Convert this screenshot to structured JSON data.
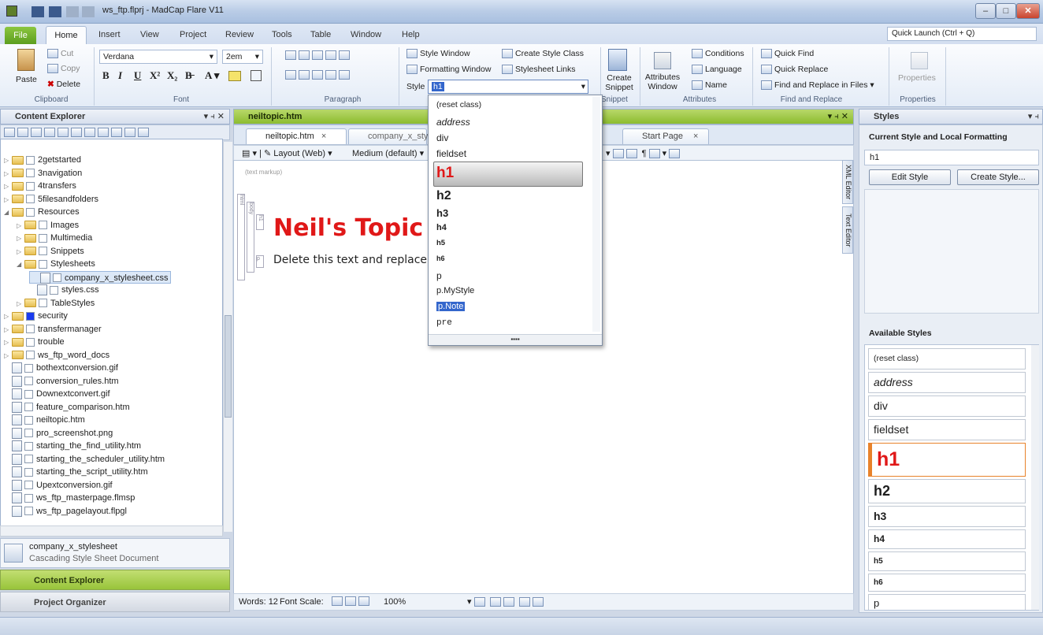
{
  "window": {
    "title": "ws_ftp.flprj - MadCap Flare V11",
    "quick_launch": "Quick Launch (Ctrl + Q)"
  },
  "ribbon_tabs": [
    "File",
    "Home",
    "Insert",
    "View",
    "Project",
    "Review",
    "Tools",
    "Table",
    "Window",
    "Help"
  ],
  "clipboard": {
    "paste": "Paste",
    "cut": "Cut",
    "copy": "Copy",
    "delete": "Delete",
    "label": "Clipboard"
  },
  "font": {
    "family": "Verdana",
    "size": "2em",
    "label": "Font"
  },
  "paragraph": {
    "label": "Paragraph"
  },
  "styles_group": {
    "style_window": "Style Window",
    "formatting_window": "Formatting Window",
    "create_style_class": "Create Style Class",
    "stylesheet_links": "Stylesheet Links",
    "style_label": "Style",
    "style_value": "h1",
    "label": "Styles"
  },
  "snippet": {
    "create": "Create",
    "snippet": "Snippet",
    "label": "Snippet"
  },
  "attributes": {
    "window1": "Attributes",
    "window2": "Window",
    "conditions": "Conditions",
    "language": "Language",
    "name": "Name",
    "label": "Attributes"
  },
  "find": {
    "quick_find": "Quick Find",
    "quick_replace": "Quick Replace",
    "find_replace_files": "Find and Replace in Files",
    "label": "Find and Replace"
  },
  "properties": {
    "button": "Properties",
    "label": "Properties"
  },
  "content_explorer": {
    "title": "Content Explorer",
    "items": [
      {
        "label": "2getstarted",
        "kind": "folder",
        "indent": 0,
        "expander": "▷"
      },
      {
        "label": "3navigation",
        "kind": "folder",
        "indent": 0,
        "expander": "▷"
      },
      {
        "label": "4transfers",
        "kind": "folder",
        "indent": 0,
        "expander": "▷"
      },
      {
        "label": "5filesandfolders",
        "kind": "folder",
        "indent": 0,
        "expander": "▷"
      },
      {
        "label": "Resources",
        "kind": "folder",
        "indent": 0,
        "expander": "◢"
      },
      {
        "label": "Images",
        "kind": "folder",
        "indent": 1,
        "expander": "▷"
      },
      {
        "label": "Multimedia",
        "kind": "folder",
        "indent": 1,
        "expander": "▷"
      },
      {
        "label": "Snippets",
        "kind": "folder",
        "indent": 1,
        "expander": "▷"
      },
      {
        "label": "Stylesheets",
        "kind": "folder",
        "indent": 1,
        "expander": "◢"
      },
      {
        "label": "company_x_stylesheet.css",
        "kind": "file",
        "indent": 2,
        "expander": "",
        "selected": true
      },
      {
        "label": "styles.css",
        "kind": "file",
        "indent": 2,
        "expander": ""
      },
      {
        "label": "TableStyles",
        "kind": "folder",
        "indent": 1,
        "expander": "▷"
      },
      {
        "label": "security",
        "kind": "folder",
        "indent": 0,
        "expander": "▷",
        "blue": true
      },
      {
        "label": "transfermanager",
        "kind": "folder",
        "indent": 0,
        "expander": "▷"
      },
      {
        "label": "trouble",
        "kind": "folder",
        "indent": 0,
        "expander": "▷"
      },
      {
        "label": "ws_ftp_word_docs",
        "kind": "folder",
        "indent": 0,
        "expander": "▷"
      },
      {
        "label": "bothextconversion.gif",
        "kind": "file",
        "indent": 0,
        "expander": ""
      },
      {
        "label": "conversion_rules.htm",
        "kind": "file",
        "indent": 0,
        "expander": ""
      },
      {
        "label": "Downextconvert.gif",
        "kind": "file",
        "indent": 0,
        "expander": ""
      },
      {
        "label": "feature_comparison.htm",
        "kind": "file",
        "indent": 0,
        "expander": ""
      },
      {
        "label": "neiltopic.htm",
        "kind": "file",
        "indent": 0,
        "expander": ""
      },
      {
        "label": "pro_screenshot.png",
        "kind": "file",
        "indent": 0,
        "expander": ""
      },
      {
        "label": "starting_the_find_utility.htm",
        "kind": "file",
        "indent": 0,
        "expander": ""
      },
      {
        "label": "starting_the_scheduler_utility.htm",
        "kind": "file",
        "indent": 0,
        "expander": ""
      },
      {
        "label": "starting_the_script_utility.htm",
        "kind": "file",
        "indent": 0,
        "expander": ""
      },
      {
        "label": "Upextconversion.gif",
        "kind": "file",
        "indent": 0,
        "expander": ""
      },
      {
        "label": "ws_ftp_masterpage.flmsp",
        "kind": "file",
        "indent": 0,
        "expander": ""
      },
      {
        "label": "ws_ftp_pagelayout.flpgl",
        "kind": "file",
        "indent": 0,
        "expander": ""
      }
    ],
    "info_name": "company_x_stylesheet",
    "info_type": "Cascading Style Sheet Document",
    "bottom_tabs": [
      "Content Explorer",
      "Project Organizer"
    ]
  },
  "editor": {
    "title": "neiltopic.htm",
    "tabs": [
      "neiltopic.htm",
      "company_x_styl",
      "Start Page"
    ],
    "layout": "Layout (Web)",
    "medium": "Medium (default)",
    "text_markup": "(text markup)",
    "heading": "Neil's Topic",
    "body_text": "Delete this text and replace",
    "side_tabs": [
      "XML Editor",
      "Text Editor"
    ],
    "struct_tags": [
      "html",
      "body",
      "h1",
      "p"
    ],
    "status_words": "Words: 12",
    "font_scale": "Font Scale:",
    "zoom": "100%"
  },
  "style_dropdown": {
    "items": [
      "(reset class)",
      "address",
      "div",
      "fieldset",
      "h1",
      "h2",
      "h3",
      "h4",
      "h5",
      "h6",
      "p",
      "p.MyStyle",
      "p.Note",
      "pre"
    ],
    "selected": "h1",
    "highlighted": "p.Note"
  },
  "styles_panel": {
    "title": "Styles",
    "current_label": "Current Style and Local Formatting",
    "current_value": "h1",
    "edit_style": "Edit Style",
    "create_style": "Create Style...",
    "available_label": "Available Styles",
    "items": [
      "(reset class)",
      "address",
      "div",
      "fieldset",
      "h1",
      "h2",
      "h3",
      "h4",
      "h5",
      "h6",
      "p"
    ]
  },
  "colors": {
    "accent_green": "#8cbc2f",
    "heading_red": "#e01818",
    "selection_blue": "#3366cc"
  }
}
